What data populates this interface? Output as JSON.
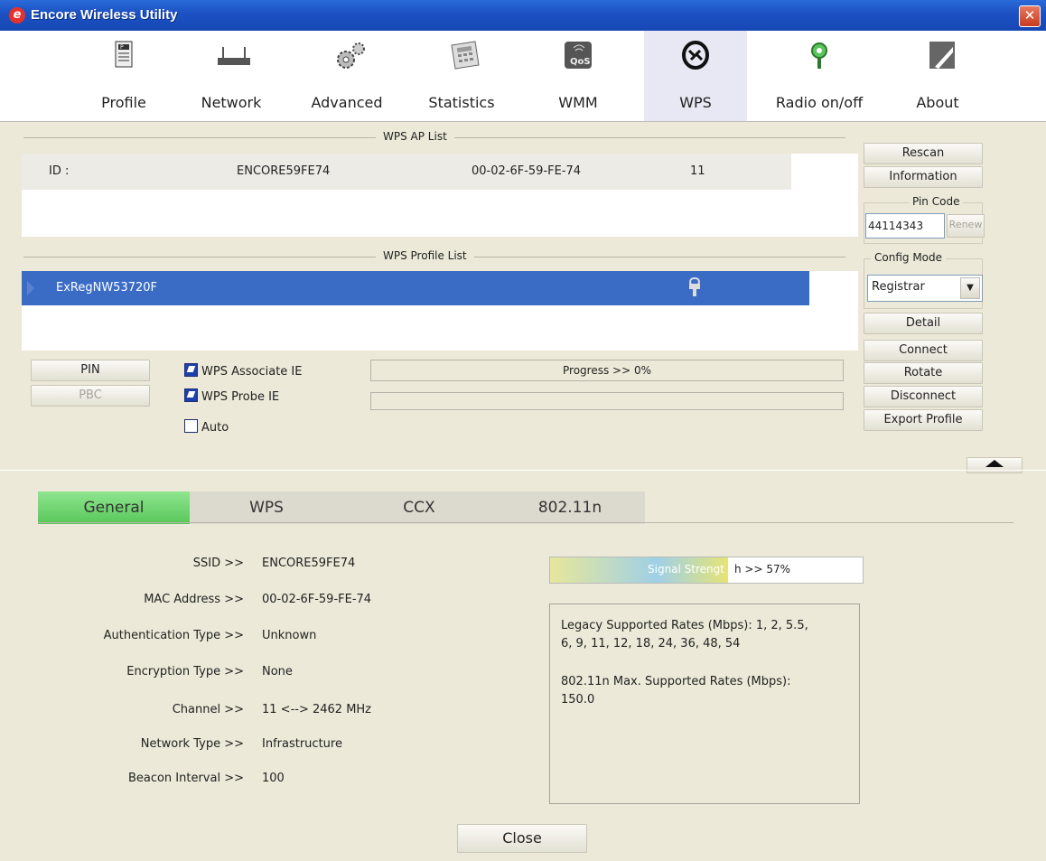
{
  "window": {
    "title": "Encore Wireless Utility"
  },
  "toolbar": {
    "items": [
      {
        "label": "Profile",
        "icon": "profile-icon"
      },
      {
        "label": "Network",
        "icon": "router-icon"
      },
      {
        "label": "Advanced",
        "icon": "gears-icon"
      },
      {
        "label": "Statistics",
        "icon": "calculator-icon"
      },
      {
        "label": "WMM",
        "icon": "qos-icon"
      },
      {
        "label": "WPS",
        "icon": "wps-icon"
      },
      {
        "label": "Radio on/off",
        "icon": "radio-icon"
      },
      {
        "label": "About",
        "icon": "encore-logo-icon"
      }
    ],
    "active": "WPS"
  },
  "ap_list": {
    "title": "WPS AP List",
    "rows": [
      {
        "id_label": "ID :",
        "ssid": "ENCORE59FE74",
        "mac": "00-02-6F-59-FE-74",
        "channel": "11"
      }
    ]
  },
  "profile_list": {
    "title": "WPS Profile List",
    "rows": [
      {
        "name": "ExRegNW53720F",
        "icon": "lock-icon"
      }
    ]
  },
  "buttons": {
    "pin": "PIN",
    "pbc": "PBC",
    "rescan": "Rescan",
    "information": "Information",
    "renew": "Renew",
    "detail": "Detail",
    "connect": "Connect",
    "rotate": "Rotate",
    "disconnect": "Disconnect",
    "export_profile": "Export Profile",
    "close": "Close"
  },
  "checkboxes": {
    "associate": {
      "label": "WPS Associate IE",
      "checked": true
    },
    "probe": {
      "label": "WPS Probe IE",
      "checked": true
    },
    "auto": {
      "label": "Auto",
      "checked": false
    }
  },
  "progress": {
    "text": "Progress >> 0%",
    "value": 0
  },
  "pin_code": {
    "label": "Pin Code",
    "value": "44114343"
  },
  "config_mode": {
    "label": "Config Mode",
    "value": "Registrar"
  },
  "tabs": [
    "General",
    "WPS",
    "CCX",
    "802.11n"
  ],
  "active_tab": "General",
  "general": {
    "fields": [
      {
        "key": "SSID >>",
        "value": "ENCORE59FE74"
      },
      {
        "key": "MAC Address >>",
        "value": "00-02-6F-59-FE-74"
      },
      {
        "key": "Authentication Type >>",
        "value": "Unknown"
      },
      {
        "key": "Encryption Type >>",
        "value": "None"
      },
      {
        "key": "Channel >>",
        "value": "11 <--> 2462 MHz"
      },
      {
        "key": "Network Type >>",
        "value": "Infrastructure"
      },
      {
        "key": "Beacon Interval >>",
        "value": "100"
      }
    ],
    "signal": {
      "label_a": "Signal Strengt",
      "label_b": "h >> 57%",
      "value": 57
    },
    "rates": {
      "legacy_1": "Legacy Supported Rates (Mbps): 1, 2, 5.5,",
      "legacy_2": "6, 9, 11, 12, 18, 24, 36, 48, 54",
      "n_1": "802.11n Max. Supported Rates (Mbps):",
      "n_2": "150.0"
    }
  },
  "colors": {
    "titlebar": "#1d52c4",
    "selection": "#3a6cc6",
    "active_tab": "#6fd46f"
  }
}
